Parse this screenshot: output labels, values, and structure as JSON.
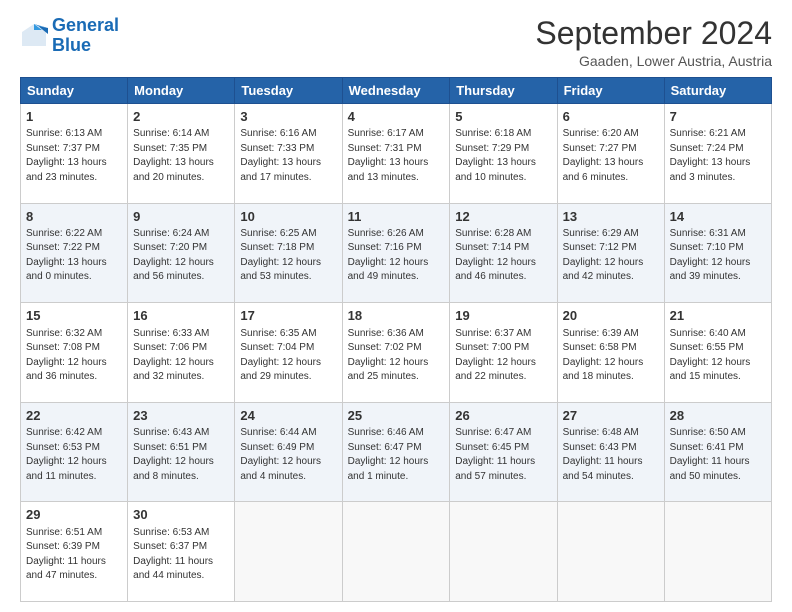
{
  "logo": {
    "line1": "General",
    "line2": "Blue"
  },
  "title": "September 2024",
  "subtitle": "Gaaden, Lower Austria, Austria",
  "days_of_week": [
    "Sunday",
    "Monday",
    "Tuesday",
    "Wednesday",
    "Thursday",
    "Friday",
    "Saturday"
  ],
  "weeks": [
    [
      {
        "day": "1",
        "info": "Sunrise: 6:13 AM\nSunset: 7:37 PM\nDaylight: 13 hours\nand 23 minutes."
      },
      {
        "day": "2",
        "info": "Sunrise: 6:14 AM\nSunset: 7:35 PM\nDaylight: 13 hours\nand 20 minutes."
      },
      {
        "day": "3",
        "info": "Sunrise: 6:16 AM\nSunset: 7:33 PM\nDaylight: 13 hours\nand 17 minutes."
      },
      {
        "day": "4",
        "info": "Sunrise: 6:17 AM\nSunset: 7:31 PM\nDaylight: 13 hours\nand 13 minutes."
      },
      {
        "day": "5",
        "info": "Sunrise: 6:18 AM\nSunset: 7:29 PM\nDaylight: 13 hours\nand 10 minutes."
      },
      {
        "day": "6",
        "info": "Sunrise: 6:20 AM\nSunset: 7:27 PM\nDaylight: 13 hours\nand 6 minutes."
      },
      {
        "day": "7",
        "info": "Sunrise: 6:21 AM\nSunset: 7:24 PM\nDaylight: 13 hours\nand 3 minutes."
      }
    ],
    [
      {
        "day": "8",
        "info": "Sunrise: 6:22 AM\nSunset: 7:22 PM\nDaylight: 13 hours\nand 0 minutes."
      },
      {
        "day": "9",
        "info": "Sunrise: 6:24 AM\nSunset: 7:20 PM\nDaylight: 12 hours\nand 56 minutes."
      },
      {
        "day": "10",
        "info": "Sunrise: 6:25 AM\nSunset: 7:18 PM\nDaylight: 12 hours\nand 53 minutes."
      },
      {
        "day": "11",
        "info": "Sunrise: 6:26 AM\nSunset: 7:16 PM\nDaylight: 12 hours\nand 49 minutes."
      },
      {
        "day": "12",
        "info": "Sunrise: 6:28 AM\nSunset: 7:14 PM\nDaylight: 12 hours\nand 46 minutes."
      },
      {
        "day": "13",
        "info": "Sunrise: 6:29 AM\nSunset: 7:12 PM\nDaylight: 12 hours\nand 42 minutes."
      },
      {
        "day": "14",
        "info": "Sunrise: 6:31 AM\nSunset: 7:10 PM\nDaylight: 12 hours\nand 39 minutes."
      }
    ],
    [
      {
        "day": "15",
        "info": "Sunrise: 6:32 AM\nSunset: 7:08 PM\nDaylight: 12 hours\nand 36 minutes."
      },
      {
        "day": "16",
        "info": "Sunrise: 6:33 AM\nSunset: 7:06 PM\nDaylight: 12 hours\nand 32 minutes."
      },
      {
        "day": "17",
        "info": "Sunrise: 6:35 AM\nSunset: 7:04 PM\nDaylight: 12 hours\nand 29 minutes."
      },
      {
        "day": "18",
        "info": "Sunrise: 6:36 AM\nSunset: 7:02 PM\nDaylight: 12 hours\nand 25 minutes."
      },
      {
        "day": "19",
        "info": "Sunrise: 6:37 AM\nSunset: 7:00 PM\nDaylight: 12 hours\nand 22 minutes."
      },
      {
        "day": "20",
        "info": "Sunrise: 6:39 AM\nSunset: 6:58 PM\nDaylight: 12 hours\nand 18 minutes."
      },
      {
        "day": "21",
        "info": "Sunrise: 6:40 AM\nSunset: 6:55 PM\nDaylight: 12 hours\nand 15 minutes."
      }
    ],
    [
      {
        "day": "22",
        "info": "Sunrise: 6:42 AM\nSunset: 6:53 PM\nDaylight: 12 hours\nand 11 minutes."
      },
      {
        "day": "23",
        "info": "Sunrise: 6:43 AM\nSunset: 6:51 PM\nDaylight: 12 hours\nand 8 minutes."
      },
      {
        "day": "24",
        "info": "Sunrise: 6:44 AM\nSunset: 6:49 PM\nDaylight: 12 hours\nand 4 minutes."
      },
      {
        "day": "25",
        "info": "Sunrise: 6:46 AM\nSunset: 6:47 PM\nDaylight: 12 hours\nand 1 minute."
      },
      {
        "day": "26",
        "info": "Sunrise: 6:47 AM\nSunset: 6:45 PM\nDaylight: 11 hours\nand 57 minutes."
      },
      {
        "day": "27",
        "info": "Sunrise: 6:48 AM\nSunset: 6:43 PM\nDaylight: 11 hours\nand 54 minutes."
      },
      {
        "day": "28",
        "info": "Sunrise: 6:50 AM\nSunset: 6:41 PM\nDaylight: 11 hours\nand 50 minutes."
      }
    ],
    [
      {
        "day": "29",
        "info": "Sunrise: 6:51 AM\nSunset: 6:39 PM\nDaylight: 11 hours\nand 47 minutes."
      },
      {
        "day": "30",
        "info": "Sunrise: 6:53 AM\nSunset: 6:37 PM\nDaylight: 11 hours\nand 44 minutes."
      },
      {
        "day": "",
        "info": ""
      },
      {
        "day": "",
        "info": ""
      },
      {
        "day": "",
        "info": ""
      },
      {
        "day": "",
        "info": ""
      },
      {
        "day": "",
        "info": ""
      }
    ]
  ]
}
